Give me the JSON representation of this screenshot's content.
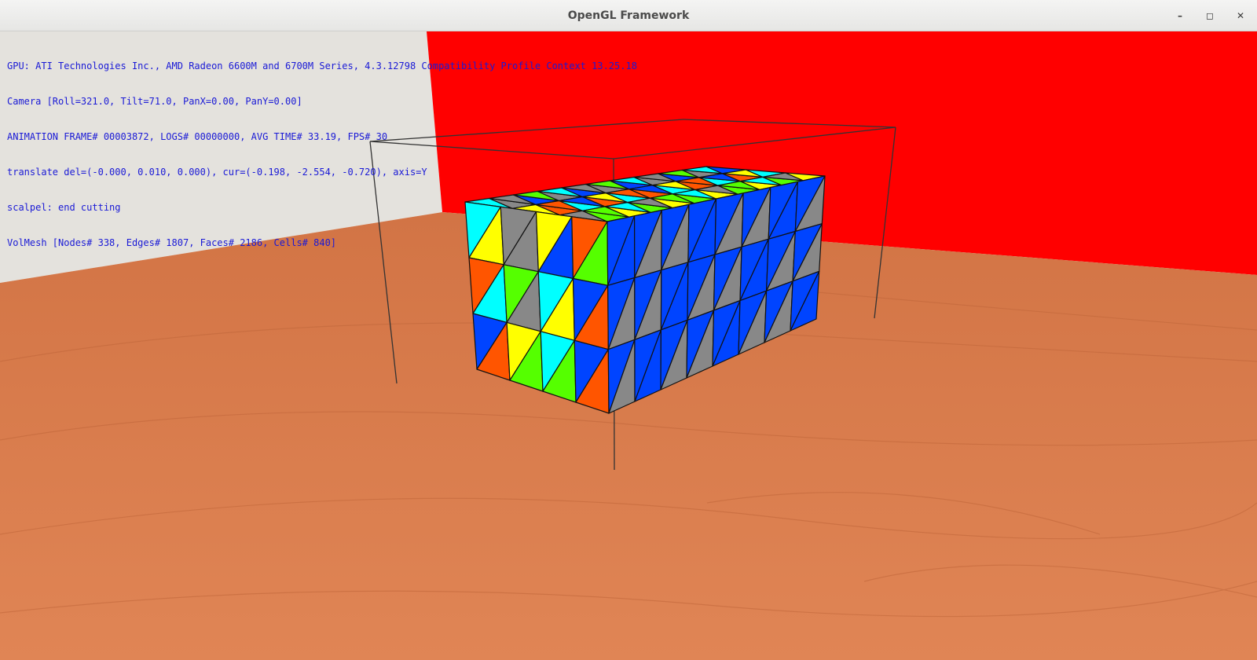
{
  "window": {
    "title": "OpenGL Framework",
    "controls": {
      "minimize": "–",
      "maximize": "◻",
      "close": "✕"
    }
  },
  "hud": {
    "lines": [
      "GPU: ATI Technologies Inc., AMD Radeon 6600M and 6700M Series, 4.3.12798 Compatibility Profile Context 13.25.18",
      "Camera [Roll=321.0, Tilt=71.0, PanX=0.00, PanY=0.00]",
      "ANIMATION FRAME# 00003872, LOGS# 00000000, AVG TIME# 33.19, FPS# 30",
      "translate del=(-0.000, 0.010, 0.000), cur=(-0.198, -2.554, -0.720), axis=Y",
      "scalpel: end cutting",
      "VolMesh [Nodes# 338, Edges# 1807, Faces# 2186, Cells# 840]"
    ]
  },
  "colors": {
    "hud_text": "#1a1ad6",
    "red_wall": "#ff0000",
    "grey_wall": "#e4e2dd",
    "floor": "#d8784a",
    "mesh_palette": [
      "#00ffff",
      "#ffff00",
      "#888888",
      "#ff5500",
      "#55ff00",
      "#0044ff"
    ]
  }
}
